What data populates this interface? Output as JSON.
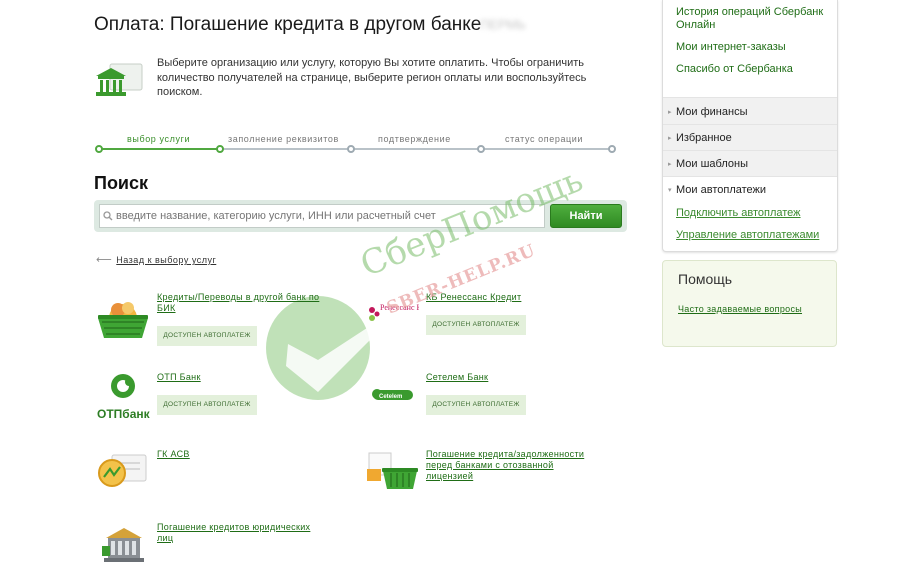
{
  "page": {
    "title": "Оплата: Погашение кредита в другом банке",
    "title_blurred": "ПЕРМЬ",
    "intro": "Выберите организацию или услугу, которую Вы хотите оплатить. Чтобы ограничить количество получателей на странице, выберите регион оплаты или воспользуйтесь поиском."
  },
  "steps": [
    {
      "label": "выбор услуги",
      "active": true
    },
    {
      "label": "заполнение реквизитов",
      "active": false
    },
    {
      "label": "подтверждение",
      "active": false
    },
    {
      "label": "статус операции",
      "active": false
    }
  ],
  "search": {
    "title": "Поиск",
    "placeholder": "введите название, категорию услуги, ИНН или расчетный счет",
    "button": "Найти"
  },
  "back_link": "Назад к выбору услуг",
  "services": [
    {
      "name": "Кредиты/Переводы в другой банк по БИК",
      "badge": "ДОСТУПЕН АВТОПЛАТЕЖ",
      "icon": "basket-money-icon"
    },
    {
      "name": "КБ Ренессанс Кредит",
      "badge": "ДОСТУПЕН АВТОПЛАТЕЖ",
      "icon": "renaissance-logo-icon",
      "logo_text": "Ренессанс Кредит"
    },
    {
      "name": "ОТП Банк",
      "badge": "ДОСТУПЕН АВТОПЛАТЕЖ",
      "icon": "otp-logo-icon",
      "logo_text": "ОТПбанк"
    },
    {
      "name": "Сетелем Банк",
      "badge": "ДОСТУПЕН АВТОПЛАТЕЖ",
      "icon": "cetelem-logo-icon",
      "logo_text": "Cetelem"
    },
    {
      "name": "ГК АСВ",
      "badge": "",
      "icon": "document-coin-icon"
    },
    {
      "name": "Погашение кредита/задолженности перед банками с отозванной лицензией",
      "badge": "",
      "icon": "basket-document-icon"
    },
    {
      "name": "Погашение кредитов юридических лиц",
      "badge": "",
      "icon": "bank-building-icon"
    }
  ],
  "watermark": {
    "text": "СберПомощь",
    "subtext": "SBER-HELP.RU"
  },
  "sidebar": {
    "links": [
      "История операций Сбербанк Онлайн",
      "Мои интернет-заказы",
      "Спасибо от Сбербанка"
    ],
    "sections": [
      "Мои финансы",
      "Избранное",
      "Мои шаблоны",
      "Мои автоплатежи"
    ],
    "autopay_links": [
      "Подключить автоплатеж",
      "Управление автоплатежами"
    ]
  },
  "help": {
    "title": "Помощь",
    "faq": "Часто задаваемые вопросы"
  },
  "colors": {
    "brand_green": "#2f8a22",
    "link_green": "#1f6d16",
    "badge_bg": "#e3f0db",
    "progress_active": "#50a840"
  }
}
